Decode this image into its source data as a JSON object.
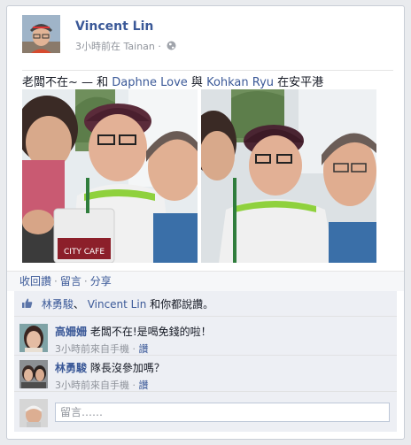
{
  "post": {
    "author": "Vincent Lin",
    "meta_time": "3小時前在",
    "meta_place": "Tainan",
    "meta_sep": "·",
    "text_prefix": "老闆不在~ — 和 ",
    "tag1": "Daphne Love",
    "text_mid": " 與 ",
    "tag2": "Kohkan Ryu",
    "text_suffix": " 在安平港",
    "icon": "globe-icon"
  },
  "photos": [
    {
      "cup_brand": "CITY CAFE"
    },
    {
      "cup_brand": ""
    }
  ],
  "actions": {
    "unlike": "收回讚",
    "comment": "留言",
    "share": "分享",
    "sep": "·"
  },
  "likes": {
    "icon": "thumbs-up-icon",
    "user1": "林勇駿",
    "sep": "、",
    "user2": "Vincent Lin",
    "suffix": " 和你都說讚。"
  },
  "comments": [
    {
      "name": "高姍姍",
      "text": "老闆不在!是喝免錢的啦！",
      "time": "3小時前來自手機",
      "sep": "·",
      "like": "讚"
    },
    {
      "name": "林勇駿",
      "text": "隊長沒參加嗎？",
      "time": "3小時前來自手機",
      "sep": "·",
      "like": "讚"
    }
  ],
  "composer": {
    "placeholder": "留言……"
  },
  "colors": {
    "link": "#3b5998",
    "border": "#c9ced6",
    "feedback_bg": "#edeff4"
  }
}
